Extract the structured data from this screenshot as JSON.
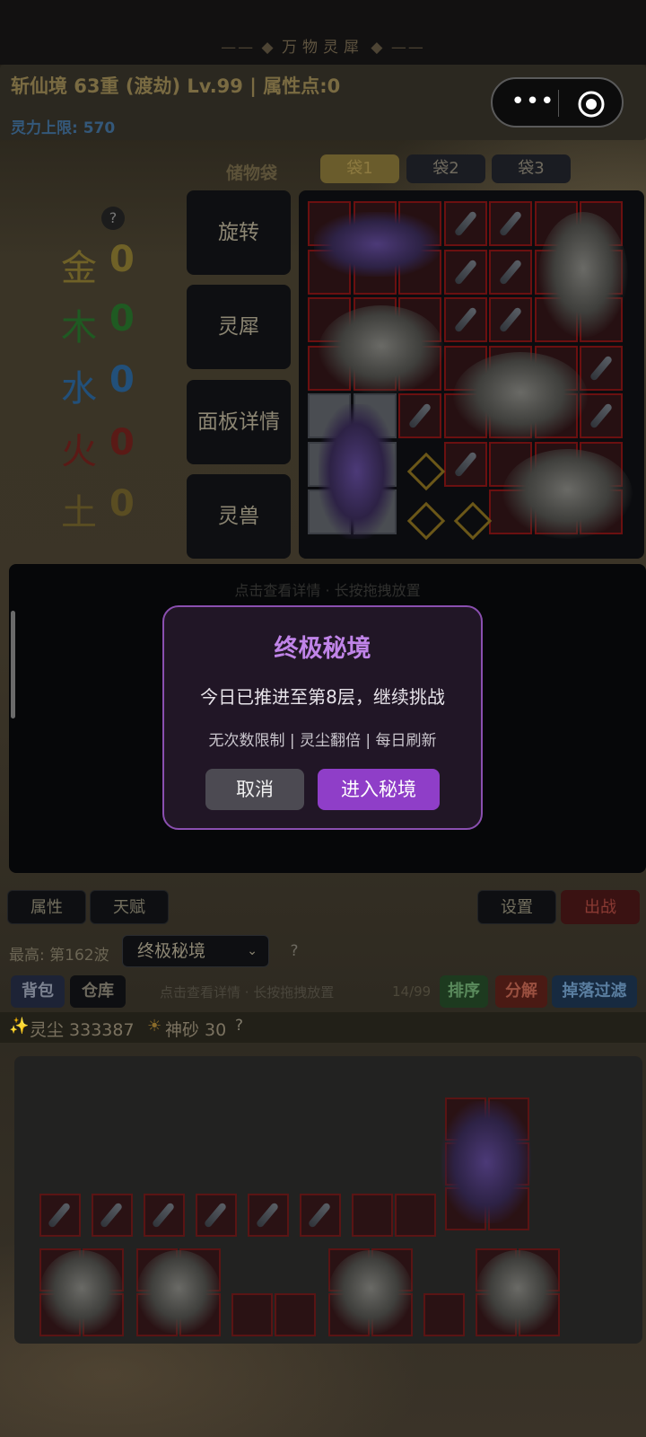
{
  "title": "万物灵犀",
  "header": {
    "realm": "斩仙境 63重 (渡劫) Lv.99 | 属性点:0",
    "mana": "灵力上限: 570"
  },
  "capsule": {
    "more": "•••"
  },
  "storage": {
    "title": "储物袋",
    "tabs": [
      "袋1",
      "袋2",
      "袋3"
    ]
  },
  "elements": [
    {
      "name": "金",
      "value": "0",
      "color": "#6f6127"
    },
    {
      "name": "木",
      "value": "0",
      "color": "#1f5a22"
    },
    {
      "name": "水",
      "value": "0",
      "color": "#22507a"
    },
    {
      "name": "火",
      "value": "0",
      "color": "#5a1a16"
    },
    {
      "name": "土",
      "value": "0",
      "color": "#5a4d22"
    }
  ],
  "help_icon": "?",
  "side_buttons": [
    "旋转",
    "灵犀",
    "面板详情",
    "灵兽"
  ],
  "panel_hint": "点击查看详情 · 长按拖拽放置",
  "modal": {
    "title": "终极秘境",
    "message": "今日已推进至第8层，继续挑战",
    "sub": "无次数限制 | 灵尘翻倍 | 每日刷新",
    "cancel": "取消",
    "enter": "进入秘境"
  },
  "tabs_row": {
    "attr": "属性",
    "talent": "天赋",
    "settings": "设置",
    "battle": "出战"
  },
  "wave": {
    "best": "最高: 第162波",
    "mode": "终极秘境",
    "chevron": "⌄"
  },
  "inventory": {
    "bag": "背包",
    "warehouse": "仓库",
    "hint": "点击查看详情 · 长按拖拽放置",
    "count": "14/99",
    "sort": "排序",
    "dismantle": "分解",
    "filter": "掉落过滤"
  },
  "currency": {
    "dust_icon": "✨",
    "dust": "灵尘 333387",
    "sand_icon": "☀",
    "sand": "神砂 30"
  }
}
